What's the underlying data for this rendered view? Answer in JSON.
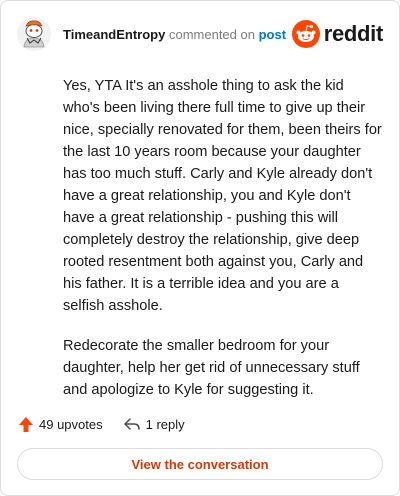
{
  "comment": {
    "username": "TimeandEntropy",
    "action_text": "commented on",
    "post_link": "post",
    "paragraphs": [
      "Yes, YTA It's an asshole thing to ask the kid who's been living there full time to give up their nice, specially renovated for them, been theirs for the last 10 years room because your daughter has too much stuff. Carly and Kyle already don't have a great relationship, you and Kyle don't have a great relationship - pushing this will completely destroy the relationship, give deep rooted resentment both against you, Carly and his father. It is a terrible idea and you are a selfish asshole.",
      "Redecorate the smaller bedroom for your daughter, help her get rid of unnecessary stuff and apologize to Kyle for suggesting it."
    ]
  },
  "brand": {
    "wordmark": "reddit",
    "icon": "reddit-snoo-icon",
    "color": "#ff4500"
  },
  "actions": {
    "upvotes": "49 upvotes",
    "replies": "1 reply",
    "upvote_color": "#ff4500"
  },
  "cta": {
    "label": "View the conversation",
    "color": "#d93a00"
  }
}
